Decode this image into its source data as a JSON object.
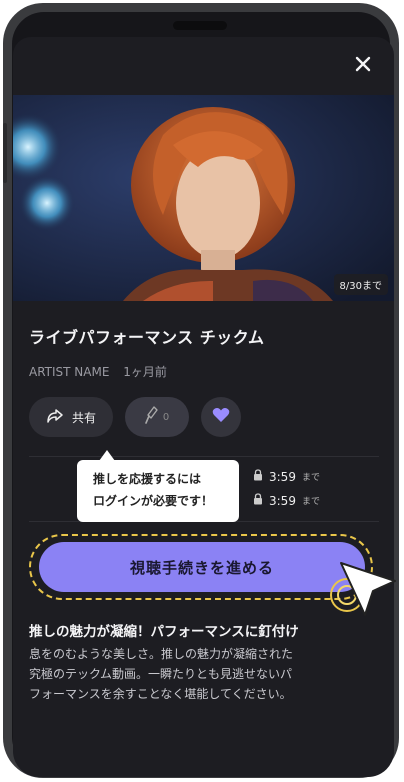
{
  "video": {
    "title": "ライブパフォーマンス チックム",
    "artist": "ARTIST NAME",
    "posted": "1ヶ月前",
    "expiry_badge": "8/30まで"
  },
  "actions": {
    "share_label": "共有",
    "cheer_count": "0"
  },
  "rows": [
    {
      "time": "3:59",
      "until": "まで"
    },
    {
      "time": "3:59",
      "until": "まで"
    }
  ],
  "tooltip": {
    "line1": "推しを応援するには",
    "line2": "ログインが必要です！"
  },
  "cta_label": "視聴手続きを進める",
  "section": {
    "title": "推しの魅力が凝縮！パフォーマンスに釘付け",
    "lines": [
      "息をのむような美しさ。推しの魅力が凝縮された",
      "究極のテックム動画。一瞬たりとも見逃せないパ",
      "フォーマンスを余すことなく堪能してください。"
    ]
  },
  "colors": {
    "accent": "#8b82f4",
    "highlight": "#e9c64a",
    "heart": "#9a8cff"
  }
}
